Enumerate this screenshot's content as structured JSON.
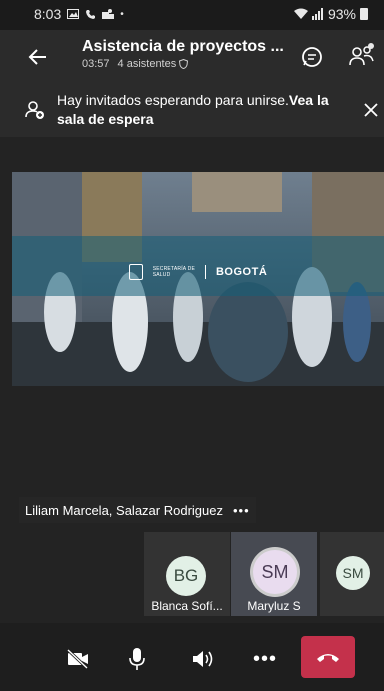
{
  "status_bar": {
    "time": "8:03",
    "notification_icons": [
      "gallery-icon",
      "phone-icon",
      "teams-icon",
      "dot-icon"
    ],
    "battery": "93%",
    "signal_icons": [
      "wifi-icon",
      "cell-signal-icon"
    ]
  },
  "header": {
    "title": "Asistencia de proyectos ...",
    "elapsed": "03:57",
    "attendees": "4 asistentes",
    "icons": [
      "back-arrow-icon",
      "shield-icon",
      "chat-icon",
      "participants-icon"
    ]
  },
  "lobby": {
    "message": "Hay invitados esperando para unirse.",
    "link": "Vea la sala de espera",
    "icons": [
      "add-person-icon",
      "close-icon"
    ]
  },
  "shared_content": {
    "logo_subtitle_line1": "SECRETARÍA DE",
    "logo_subtitle_line2": "SALUD",
    "logo_city": "BOGOTÁ"
  },
  "speaker": {
    "names": "Liliam Marcela, Salazar Rodriguez",
    "more": "•••"
  },
  "participants": [
    {
      "initials": "BG",
      "name": "Blanca Sofí..."
    },
    {
      "initials": "SM",
      "name": "Maryluz S"
    },
    {
      "initials": "SM",
      "name": ""
    }
  ],
  "controls": {
    "more": "•••",
    "icons": [
      "video-off-icon",
      "microphone-icon",
      "speaker-icon",
      "more-icon",
      "hang-up-icon"
    ]
  },
  "colors": {
    "background": "#232323",
    "hang_up": "#c4314b",
    "avatar_green": "#e2f0e6",
    "avatar_purple": "#e9dcef"
  }
}
